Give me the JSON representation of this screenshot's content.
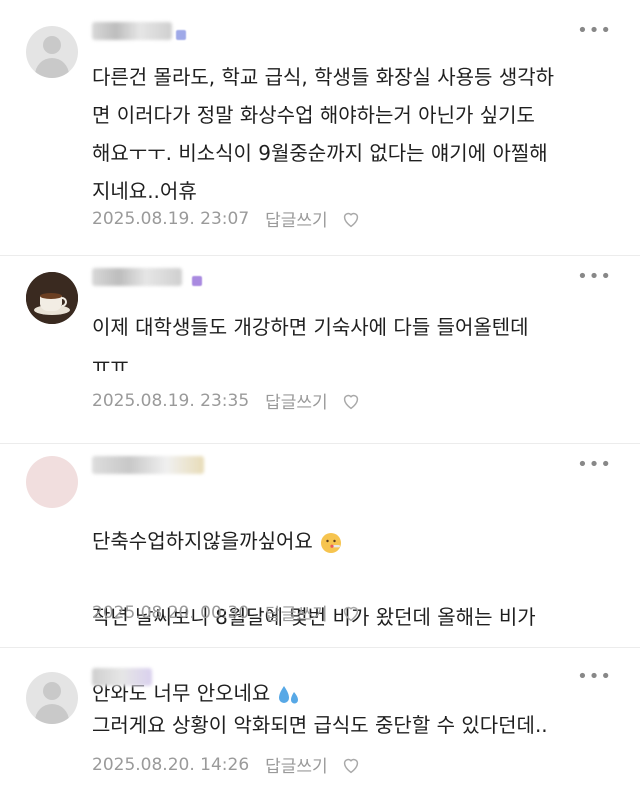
{
  "comments": [
    {
      "text": "다른건 몰라도, 학교 급식, 학생들 화장실 사용등 생각하\n면 이러다가 정말 화상수업 해야하는거 아닌가 싶기도\n해요ㅜㅜ. 비소식이 9월중순까지 없다는 얘기에 아찔해\n지네요..어휴",
      "date": "2025.08.19. 23:07",
      "reply_label": "답글쓰기"
    },
    {
      "text": "이제 대학생들도 개강하면 기숙사에 다들 들어올텐데\nㅠㅠ",
      "date": "2025.08.19. 23:35",
      "reply_label": "답글쓰기"
    },
    {
      "line1": "단축수업하지않을까싶어요",
      "line2": "작년 날씨보니 8월달에 몇번 비가 왔던데 올해는 비가",
      "line3": "안와도 너무 안오네요",
      "date": "2025.08.20. 00:30",
      "reply_label": "답글쓰기"
    },
    {
      "text": "그러게요 상황이 악화되면 급식도 중단할 수 있다던데..",
      "date": "2025.08.20. 14:26",
      "reply_label": "답글쓰기"
    }
  ],
  "more_glyph": "•••",
  "icons": {
    "avatar_default": "default-profile-icon",
    "avatar_coffee": "coffee-cup-photo",
    "heart": "heart-outline-icon",
    "emoji_worried": "face-with-thermometer-emoji",
    "emoji_sweat": "sweat-droplets-emoji"
  }
}
